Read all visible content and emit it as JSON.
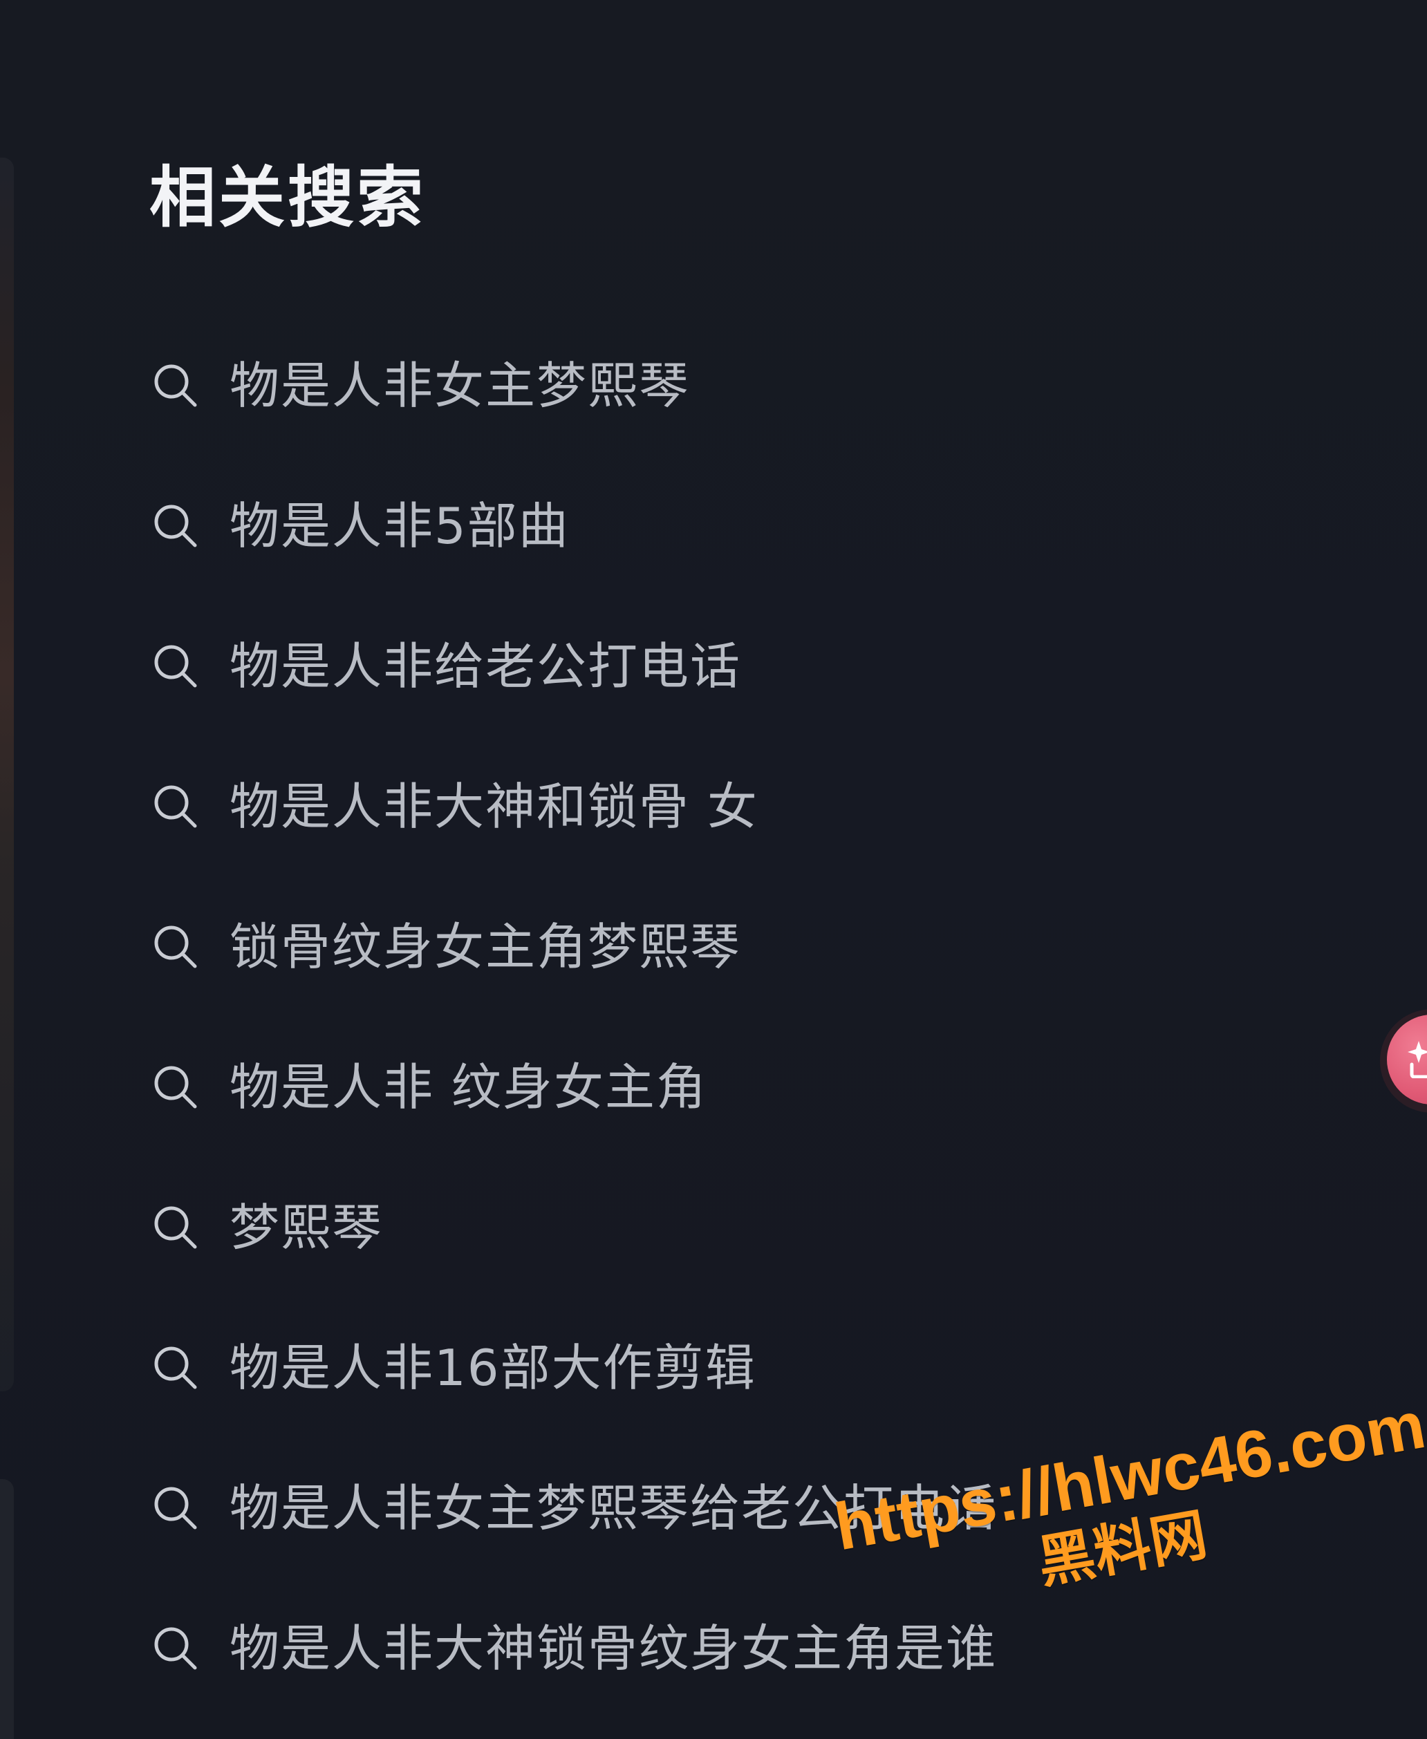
{
  "header": {
    "title": "相关搜索"
  },
  "search_items": [
    {
      "label": "物是人非女主梦熙琴"
    },
    {
      "label": "物是人非5部曲"
    },
    {
      "label": "物是人非给老公打电话"
    },
    {
      "label": "物是人非大神和锁骨 女"
    },
    {
      "label": "锁骨纹身女主角梦熙琴"
    },
    {
      "label": "物是人非 纹身女主角"
    },
    {
      "label": "梦熙琴"
    },
    {
      "label": "物是人非16部大作剪辑"
    },
    {
      "label": "物是人非女主梦熙琴给老公打电话"
    },
    {
      "label": "物是人非大神锁骨纹身女主角是谁"
    }
  ],
  "watermark": {
    "url": "https://hlwc46.com",
    "site_name": "黑料网"
  },
  "colors": {
    "background": "#161922",
    "title": "#f2f3f6",
    "item_text": "#b8bcc4",
    "icon": "#c9ccd3",
    "watermark": "#ff9b1f",
    "side_button": "#e15b76"
  },
  "icons": {
    "search": "search-icon",
    "side_button": "sparkle-icon"
  }
}
